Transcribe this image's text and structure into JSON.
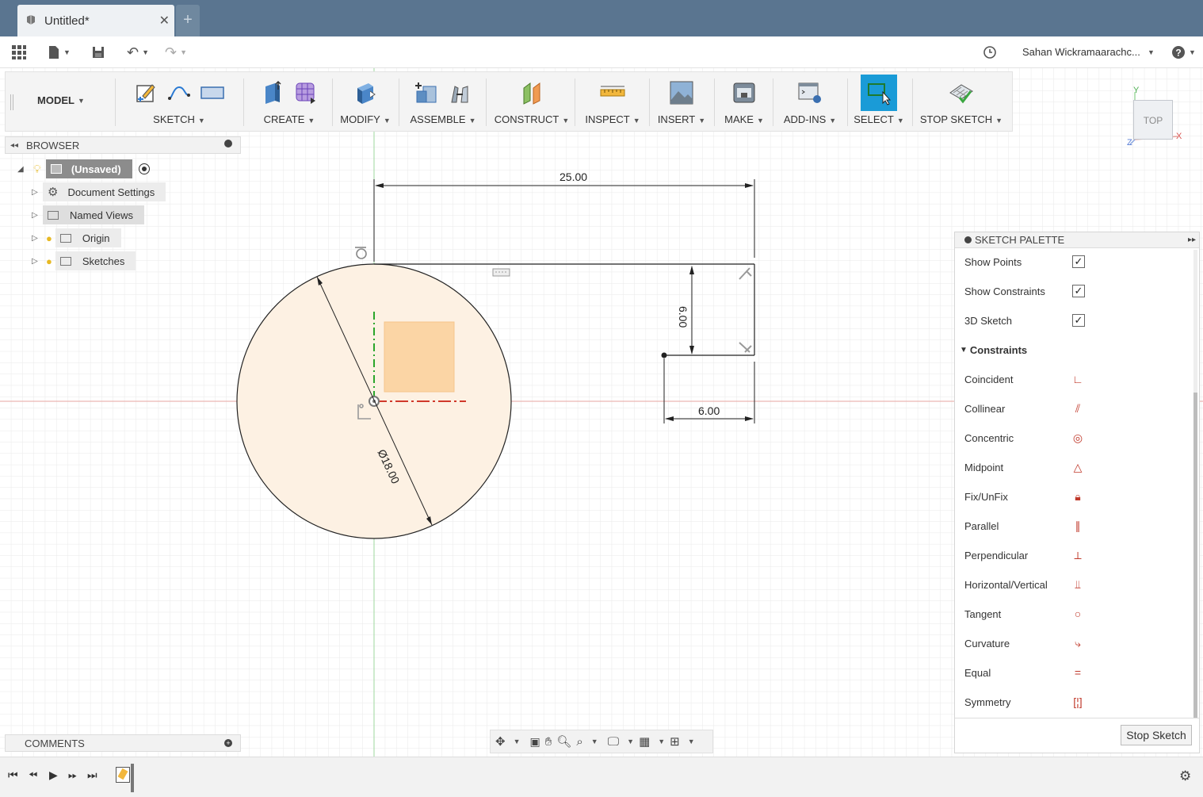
{
  "window": {
    "doc_title": "Untitled*",
    "new_tab_icon": "plus-icon"
  },
  "quick_access": {
    "user_name": "Sahan Wickramaarachc...",
    "help_icon": "help-icon"
  },
  "toolbar": {
    "workspace": "MODEL",
    "groups": {
      "sketch": "SKETCH",
      "create": "CREATE",
      "modify": "MODIFY",
      "assemble": "ASSEMBLE",
      "construct": "CONSTRUCT",
      "inspect": "INSPECT",
      "insert": "INSERT",
      "make": "MAKE",
      "addins": "ADD-INS",
      "select": "SELECT",
      "stop_sketch": "STOP SKETCH"
    }
  },
  "browser": {
    "title": "BROWSER",
    "root": "(Unsaved)",
    "items": [
      {
        "label": "Document Settings"
      },
      {
        "label": "Named Views"
      },
      {
        "label": "Origin"
      },
      {
        "label": "Sketches"
      }
    ]
  },
  "comments": {
    "title": "COMMENTS"
  },
  "sketch": {
    "dim_width": "25.00",
    "dim_height": "6.00",
    "dim_bottom": "6.00",
    "dim_diameter": "Ø18.00"
  },
  "viewcube": {
    "face": "TOP",
    "axis_x": "X",
    "axis_y": "Y",
    "axis_z": "Z"
  },
  "palette": {
    "title": "SKETCH PALETTE",
    "options": [
      {
        "label": "Show Points",
        "checked": true
      },
      {
        "label": "Show Constraints",
        "checked": true
      },
      {
        "label": "3D Sketch",
        "checked": true
      }
    ],
    "constraints_header": "Constraints",
    "constraints": [
      {
        "label": "Coincident",
        "icon": "coincident-icon"
      },
      {
        "label": "Collinear",
        "icon": "collinear-icon"
      },
      {
        "label": "Concentric",
        "icon": "concentric-icon"
      },
      {
        "label": "Midpoint",
        "icon": "midpoint-icon"
      },
      {
        "label": "Fix/UnFix",
        "icon": "lock-icon"
      },
      {
        "label": "Parallel",
        "icon": "parallel-icon"
      },
      {
        "label": "Perpendicular",
        "icon": "perpendicular-icon"
      },
      {
        "label": "Horizontal/Vertical",
        "icon": "horizontal-vertical-icon"
      },
      {
        "label": "Tangent",
        "icon": "tangent-icon"
      },
      {
        "label": "Curvature",
        "icon": "curvature-icon"
      },
      {
        "label": "Equal",
        "icon": "equal-icon"
      },
      {
        "label": "Symmetry",
        "icon": "symmetry-icon"
      }
    ],
    "stop_button": "Stop Sketch"
  }
}
